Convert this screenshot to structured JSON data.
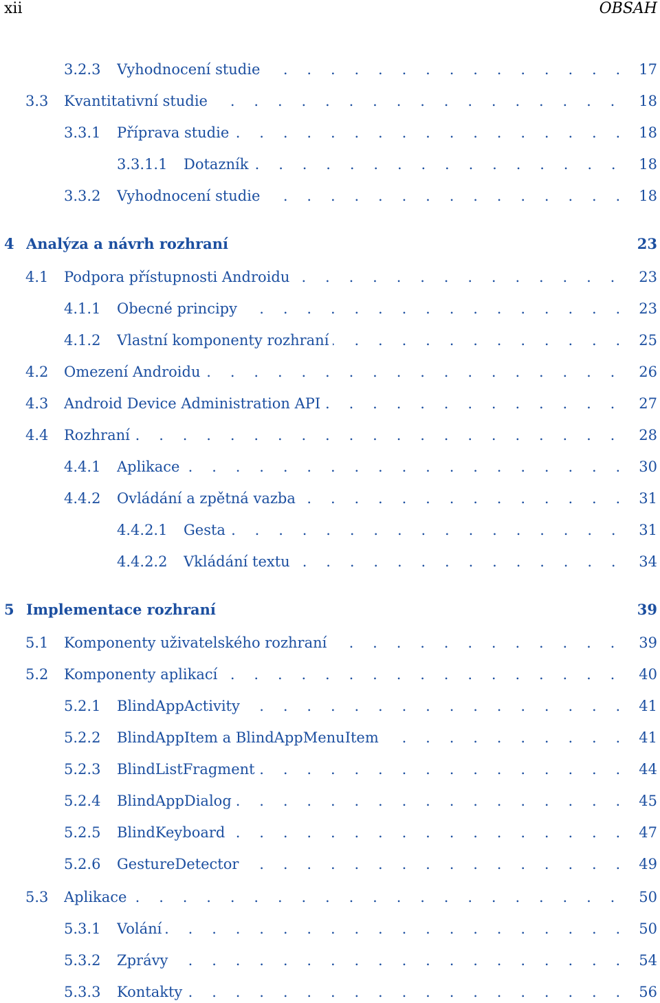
{
  "header": {
    "page_number": "xii",
    "title": "OBSAH"
  },
  "entries": [
    {
      "level": 2,
      "type": "section",
      "number": "3.2.3",
      "title": "Vyhodnocení studie",
      "page": "17"
    },
    {
      "level": 1,
      "type": "section",
      "number": "3.3",
      "title": "Kvantitativní studie",
      "page": "18"
    },
    {
      "level": 2,
      "type": "section",
      "number": "3.3.1",
      "title": "Příprava studie",
      "page": "18"
    },
    {
      "level": 3,
      "type": "section",
      "number": "3.3.1.1",
      "title": "Dotazník",
      "page": "18"
    },
    {
      "level": 2,
      "type": "section",
      "number": "3.3.2",
      "title": "Vyhodnocení studie",
      "page": "18"
    },
    {
      "level": 0,
      "type": "chapter",
      "number": "4",
      "title": "Analýza a návrh rozhraní",
      "page": "23"
    },
    {
      "level": 1,
      "type": "section",
      "number": "4.1",
      "title": "Podpora přístupnosti Androidu",
      "page": "23"
    },
    {
      "level": 2,
      "type": "section",
      "number": "4.1.1",
      "title": "Obecné principy",
      "page": "23"
    },
    {
      "level": 2,
      "type": "section",
      "number": "4.1.2",
      "title": "Vlastní komponenty rozhraní",
      "page": "25"
    },
    {
      "level": 1,
      "type": "section",
      "number": "4.2",
      "title": "Omezení Androidu",
      "page": "26"
    },
    {
      "level": 1,
      "type": "section",
      "number": "4.3",
      "title": "Android Device Administration API",
      "page": "27"
    },
    {
      "level": 1,
      "type": "section",
      "number": "4.4",
      "title": "Rozhraní",
      "page": "28"
    },
    {
      "level": 2,
      "type": "section",
      "number": "4.4.1",
      "title": "Aplikace",
      "page": "30"
    },
    {
      "level": 2,
      "type": "section",
      "number": "4.4.2",
      "title": "Ovládání a zpětná vazba",
      "page": "31"
    },
    {
      "level": 3,
      "type": "section",
      "number": "4.4.2.1",
      "title": "Gesta",
      "page": "31"
    },
    {
      "level": 3,
      "type": "section",
      "number": "4.4.2.2",
      "title": "Vkládání textu",
      "page": "34"
    },
    {
      "level": 0,
      "type": "chapter",
      "number": "5",
      "title": "Implementace rozhraní",
      "page": "39"
    },
    {
      "level": 1,
      "type": "section",
      "number": "5.1",
      "title": "Komponenty uživatelského rozhraní",
      "page": "39"
    },
    {
      "level": 1,
      "type": "section",
      "number": "5.2",
      "title": "Komponenty aplikací",
      "page": "40"
    },
    {
      "level": 2,
      "type": "section",
      "number": "5.2.1",
      "title": "BlindAppActivity",
      "page": "41"
    },
    {
      "level": 2,
      "type": "section",
      "number": "5.2.2",
      "title": "BlindAppItem a BlindAppMenuItem",
      "page": "41"
    },
    {
      "level": 2,
      "type": "section",
      "number": "5.2.3",
      "title": "BlindListFragment",
      "page": "44"
    },
    {
      "level": 2,
      "type": "section",
      "number": "5.2.4",
      "title": "BlindAppDialog",
      "page": "45"
    },
    {
      "level": 2,
      "type": "section",
      "number": "5.2.5",
      "title": "BlindKeyboard",
      "page": "47"
    },
    {
      "level": 2,
      "type": "section",
      "number": "5.2.6",
      "title": "GestureDetector",
      "page": "49"
    },
    {
      "level": 1,
      "type": "section",
      "number": "5.3",
      "title": "Aplikace",
      "page": "50"
    },
    {
      "level": 2,
      "type": "section",
      "number": "5.3.1",
      "title": "Volání",
      "page": "50"
    },
    {
      "level": 2,
      "type": "section",
      "number": "5.3.2",
      "title": "Zprávy",
      "page": "54"
    },
    {
      "level": 2,
      "type": "section",
      "number": "5.3.3",
      "title": "Kontakty",
      "page": "56"
    }
  ]
}
